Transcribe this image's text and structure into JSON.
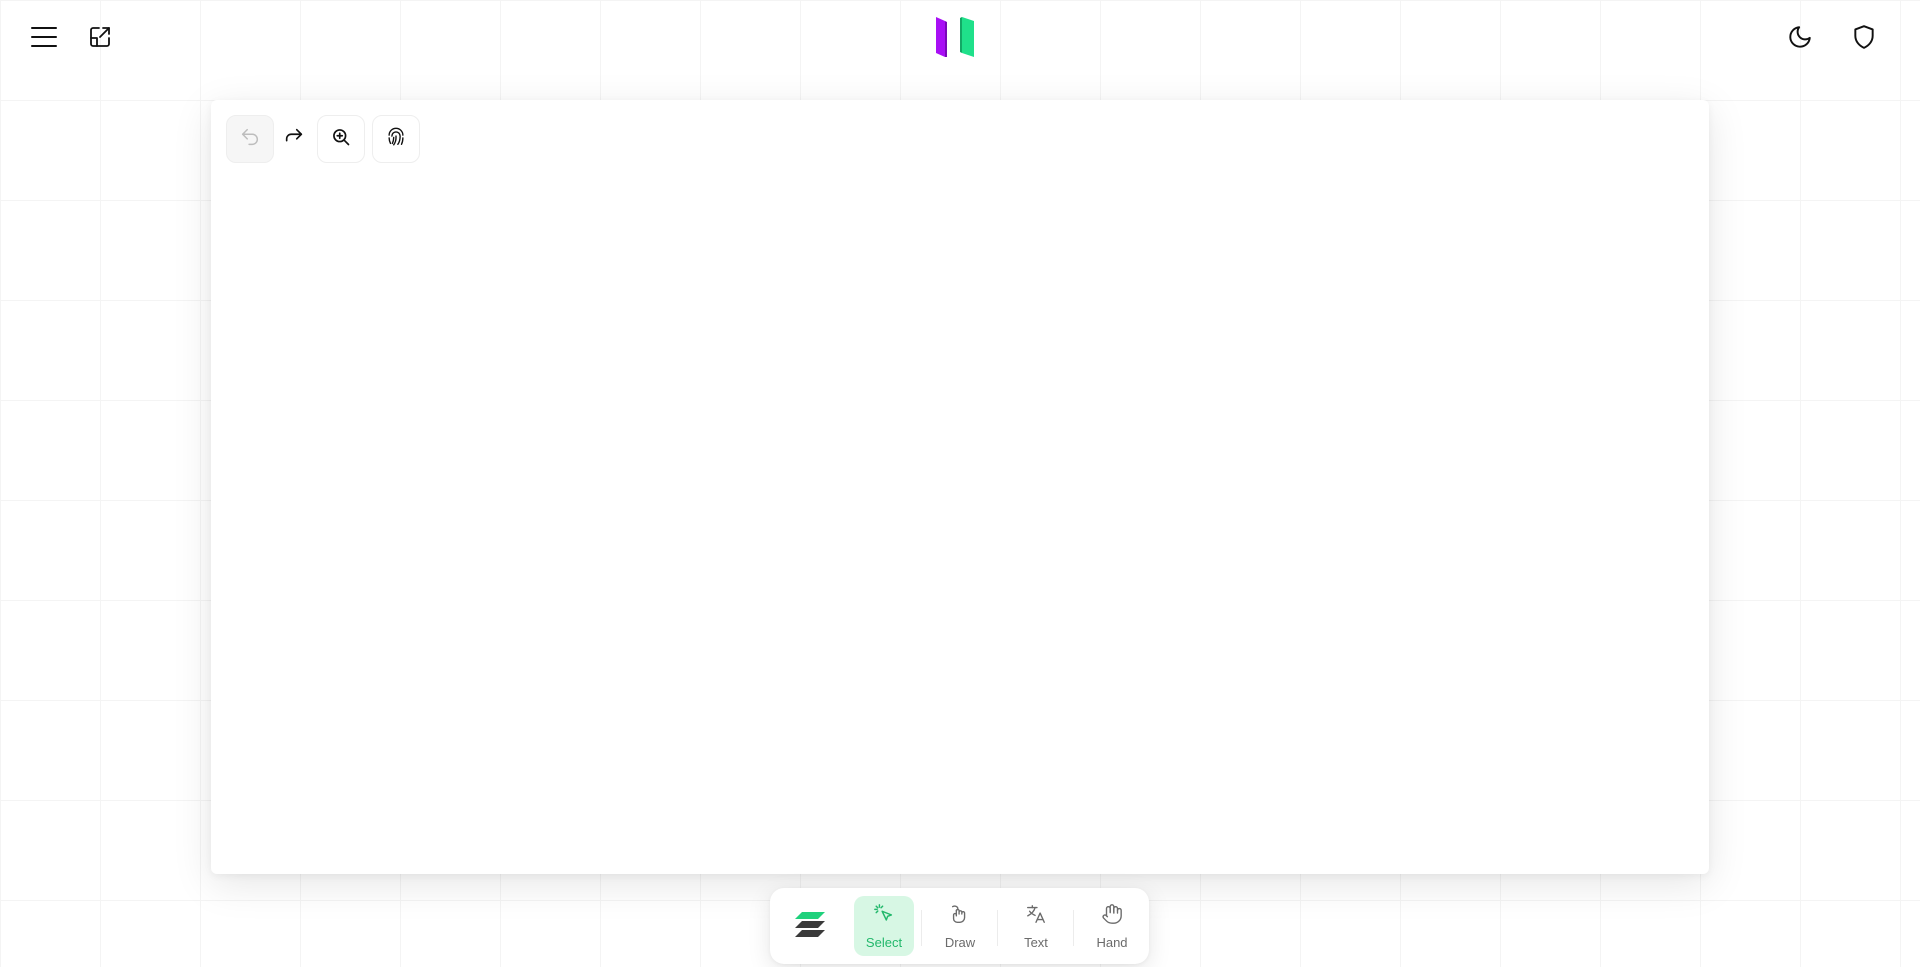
{
  "header": {
    "menu_icon": "hamburger-menu-icon",
    "share_icon": "external-link-icon",
    "logo_icon": "app-logo",
    "theme_icon": "moon-icon",
    "privacy_icon": "shield-icon"
  },
  "canvas": {
    "tools": [
      {
        "name": "undo",
        "icon": "undo-icon",
        "enabled": false
      },
      {
        "name": "redo",
        "icon": "redo-icon",
        "enabled": true
      },
      {
        "name": "zoom",
        "icon": "zoom-in-icon",
        "enabled": true
      },
      {
        "name": "fingerprint",
        "icon": "fingerprint-icon",
        "enabled": true
      }
    ]
  },
  "toolbar": {
    "layers_icon": "layers-icon",
    "tools": [
      {
        "label": "Select",
        "icon": "select-cursor-icon",
        "active": true
      },
      {
        "label": "Draw",
        "icon": "draw-hand-icon",
        "active": false
      },
      {
        "label": "Text",
        "icon": "translate-text-icon",
        "active": false
      },
      {
        "label": "Hand",
        "icon": "hand-icon",
        "active": false
      }
    ]
  },
  "colors": {
    "accent": "#22b86b",
    "active_bg": "#d7f7e4",
    "logo_purple": "#a80ff5",
    "logo_green": "#1fe08a"
  }
}
